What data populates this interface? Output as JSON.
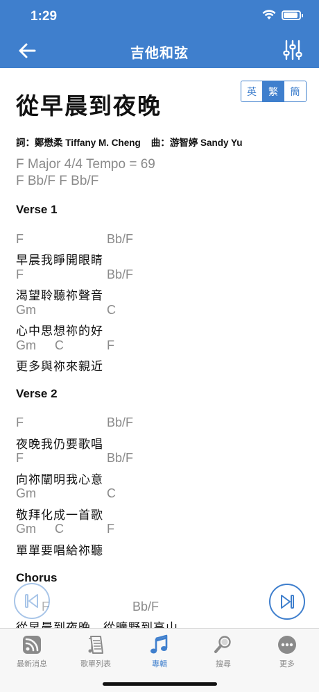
{
  "status": {
    "time": "1:29"
  },
  "nav": {
    "title": "吉他和弦"
  },
  "song": {
    "title": "從早晨到夜晚",
    "credits": "詞：鄭懋柔 Tiffany M. Cheng    曲：游智婷 Sandy Yu",
    "meta_line1": "F Major 4/4 Tempo = 69",
    "meta_line2": "F Bb/F F Bb/F"
  },
  "lang": [
    {
      "label": "英",
      "active": false
    },
    {
      "label": "繁",
      "active": true
    },
    {
      "label": "簡",
      "active": false
    }
  ],
  "verse1": {
    "title": "Verse 1",
    "lines": [
      {
        "chords": [
          "F",
          "Bb/F"
        ],
        "lyric": "早晨我睜開眼睛"
      },
      {
        "chords": [
          "F",
          "Bb/F"
        ],
        "lyric": "渴望聆聽祢聲音"
      },
      {
        "chords": [
          "Gm",
          "C"
        ],
        "lyric": "心中思想祢的好"
      },
      {
        "chords": [
          "Gm",
          "C",
          "F"
        ],
        "lyric": "更多與祢來親近"
      }
    ]
  },
  "verse2": {
    "title": "Verse 2",
    "lines": [
      {
        "chords": [
          "F",
          "Bb/F"
        ],
        "lyric": "夜晚我仍要歌唱"
      },
      {
        "chords": [
          "F",
          "Bb/F"
        ],
        "lyric": "向祢闡明我心意"
      },
      {
        "chords": [
          "Gm",
          "C"
        ],
        "lyric": "敬拜化成一首歌"
      },
      {
        "chords": [
          "Gm",
          "C",
          "F"
        ],
        "lyric": "單單要唱給祢聽"
      }
    ]
  },
  "chorus": {
    "title": "Chorus",
    "lines": [
      {
        "chords": [
          "F",
          "Bb/F"
        ],
        "lyric": "從早晨到夜晚　從曠野到高山"
      }
    ]
  },
  "tabs": [
    {
      "label": "最新消息",
      "icon": "rss-icon",
      "active": false
    },
    {
      "label": "歌單列表",
      "icon": "songlist-icon",
      "active": false
    },
    {
      "label": "專輯",
      "icon": "music-note-icon",
      "active": true
    },
    {
      "label": "搜尋",
      "icon": "search-icon",
      "active": false
    },
    {
      "label": "更多",
      "icon": "more-icon",
      "active": false
    }
  ],
  "colors": {
    "primary": "#3f7fcd",
    "chord": "#8a8a8a",
    "tab_inactive": "#8a8a8a"
  }
}
